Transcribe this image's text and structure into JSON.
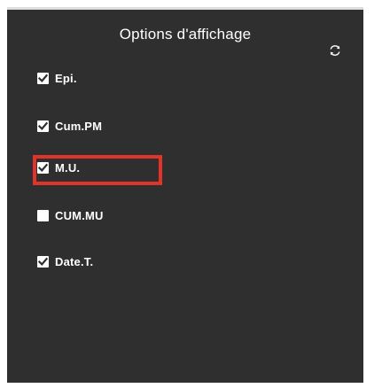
{
  "panel": {
    "title": "Options d'affichage",
    "refresh_icon": "refresh-icon"
  },
  "options": [
    {
      "label": "Epi.",
      "checked": true
    },
    {
      "label": "Cum.PM",
      "checked": true
    },
    {
      "label": "M.U.",
      "checked": true
    },
    {
      "label": "CUM.MU",
      "checked": false
    },
    {
      "label": "Date.T.",
      "checked": true
    }
  ],
  "colors": {
    "panel_bg": "#2f2f2f",
    "text": "#ffffff",
    "highlight": "#e0342a"
  }
}
